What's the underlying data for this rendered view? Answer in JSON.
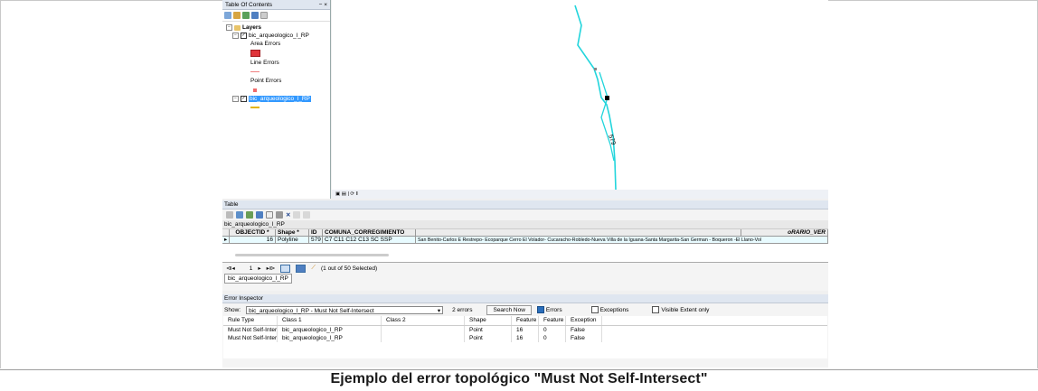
{
  "toc": {
    "title": "Table Of Contents",
    "pin_close": "− ×",
    "layers_label": "Layers",
    "layer1_name": "bic_arqueologico_l_RP",
    "area_errors": "Area Errors",
    "line_errors": "Line Errors",
    "point_errors": "Point Errors",
    "layer2_name": "bic_arqueologico_l_RP"
  },
  "map": {
    "line_label": "579",
    "statusbar_icons": "▣ ▤ | ⟳ ‖"
  },
  "table": {
    "title": "Table",
    "layer_name": "bic_arqueologico_l_RP",
    "headers": [
      "OBJECTID *",
      "Shape *",
      "ID",
      "COMUNA_CORREGIMIENTO",
      "",
      "oRARIO_VER"
    ],
    "row": [
      "16",
      "Polyline",
      "579",
      "C7 C11 C12 C13 SC SSP",
      "San Benito-Carlos E Restrepo- Ecoparque Cerro El Volador- Cucaracho-Robledo-Nueva Villa de la Iguana-Santa Margarita-San German - Boqueron -El Llano-Vol",
      ""
    ],
    "nav_first": "⧏◂",
    "nav_prev": "◂",
    "record_num": "1",
    "nav_next": "▸",
    "nav_last": "▸⧐",
    "selection_text": "(1 out of 50 Selected)",
    "tab_label": "bic_arqueologico_l_RP"
  },
  "error_inspector": {
    "title": "Error Inspector",
    "show_label": "Show:",
    "show_value": "bic_arqueologico_l_RP - Must Not Self-Intersect",
    "error_count": "2 errors",
    "search_button": "Search Now",
    "errors_label": "Errors",
    "exceptions_label": "Exceptions",
    "visible_extent_label": "Visible Extent only",
    "errors_checked": true,
    "exceptions_checked": false,
    "visible_extent_checked": false,
    "columns": [
      "Rule Type",
      "Class 1",
      "Class 2",
      "Shape",
      "Feature 1",
      "Feature 2",
      "Exception"
    ],
    "rows": [
      [
        "Must Not Self-Intersect",
        "bic_arqueologico_l_RP",
        "",
        "Point",
        "16",
        "0",
        "False"
      ],
      [
        "Must Not Self-Intersect",
        "bic_arqueologico_l_RP",
        "",
        "Point",
        "16",
        "0",
        "False"
      ]
    ]
  },
  "caption": "Ejemplo del error topológico \"Must Not Self-Intersect\"",
  "colors": {
    "line": "#22d5dc",
    "selection": "#3399ff",
    "area_error": "#e0343a",
    "point_error": "#f06a6a",
    "line_error_symbol": "#e4b400"
  }
}
